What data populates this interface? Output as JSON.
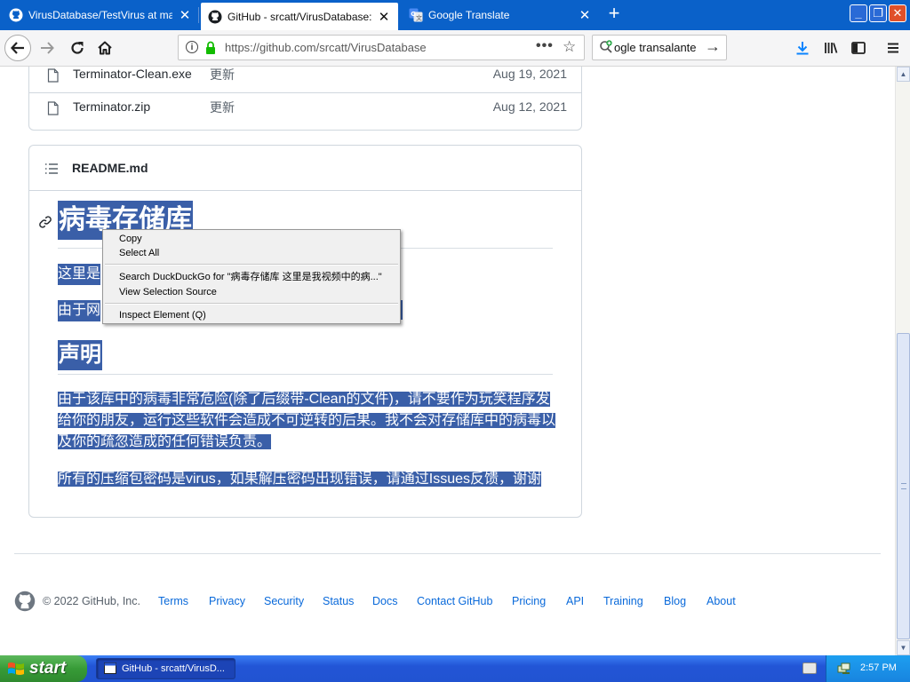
{
  "browser": {
    "tabs": [
      {
        "label": "VirusDatabase/TestVirus at maste",
        "active": false
      },
      {
        "label": "GitHub - srcatt/VirusDatabase: My",
        "active": true
      },
      {
        "label": "Google Translate",
        "active": false
      }
    ],
    "new_tab": "+",
    "window_buttons": {
      "minimize": "_",
      "maximize": "❐",
      "close": "✕"
    },
    "url": "https://github.com/srcatt/VirusDatabase",
    "url_info": "i",
    "page_actions": "•••",
    "bookmark_star": "☆",
    "search_text": "ogle transalante",
    "search_go": "→"
  },
  "files": [
    {
      "name": "Terminator-Clean.exe",
      "message": "更新",
      "date": "Aug 19, 2021"
    },
    {
      "name": "Terminator.zip",
      "message": "更新",
      "date": "Aug 12, 2021"
    }
  ],
  "readme": {
    "filename": "README.md",
    "h1": "病毒存储库",
    "p1": "这里是",
    "p2": "由于网",
    "h2": "声明",
    "p3": "由于该库中的病毒非常危险(除了后缀带-Clean的文件)，请不要作为玩笑程序发给你的朋友，运行这些软件会造成不可逆转的后果。我不会对存储库中的病毒以及你的疏忽造成的任何错误负责。",
    "p4": "所有的压缩包密码是virus，如果解压密码出现错误，请通过Issues反馈，谢谢"
  },
  "context_menu": {
    "copy": "Copy",
    "select_all": "Select All",
    "search": "Search DuckDuckGo for \"病毒存储库 这里是我视频中的病...\"",
    "view_source": "View Selection Source",
    "inspect": "Inspect Element (Q)"
  },
  "footer": {
    "copyright": "© 2022 GitHub, Inc.",
    "links": [
      "Terms",
      "Privacy",
      "Security",
      "Status",
      "Docs",
      "Contact GitHub",
      "Pricing",
      "API",
      "Training",
      "Blog",
      "About"
    ]
  },
  "taskbar": {
    "start": "start",
    "task": "GitHub - srcatt/VirusD...",
    "clock": "2:57 PM"
  },
  "colors": {
    "tabstrip": "#0a61c9",
    "selection": "#3a5fa8",
    "link": "#0969da",
    "taskbar": "#2255d6",
    "start_button": "#379b37"
  }
}
